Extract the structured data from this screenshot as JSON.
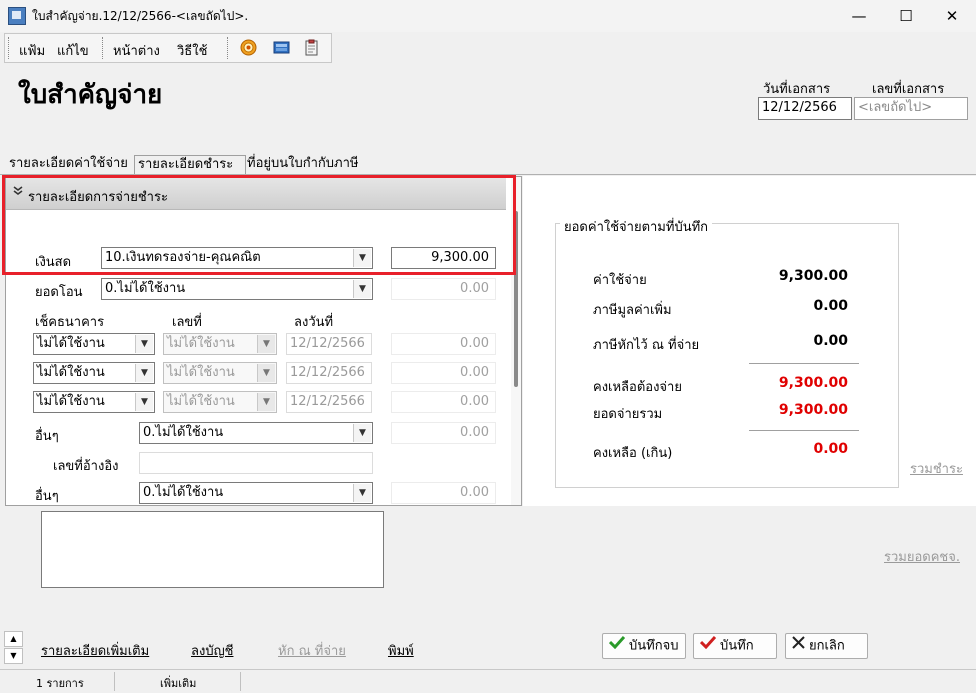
{
  "window": {
    "title": "ใบสำคัญจ่าย.12/12/2566-<เลขถัดไป>.",
    "minimize_glyph": "—",
    "maximize_glyph": "☐",
    "close_glyph": "✕"
  },
  "menu": {
    "items": [
      "แฟ้ม",
      "แก้ไข",
      "หน้าต่าง",
      "วิธีใช้"
    ]
  },
  "toolbar": {
    "icons": [
      "target-icon",
      "screen-icon",
      "clipboard-icon"
    ]
  },
  "header": {
    "page_title": "ใบสำคัญจ่าย",
    "doc_date_label": "วันที่เอกสาร",
    "doc_no_label": "เลขที่เอกสาร",
    "doc_date_value": "12/12/2566",
    "doc_no_placeholder": "<เลขถัดไป>"
  },
  "tabs": [
    "รายละเอียดค่าใช้จ่าย",
    "รายละเอียดชำระ",
    "ที่อยู่บนใบกำกับภาษี"
  ],
  "active_tab": 1,
  "payment_section": {
    "header": "รายละเอียดการจ่ายชำระ",
    "cash_label": "เงินสด",
    "cash_account": "10.เงินทดรองจ่าย-คุณคณิต",
    "cash_amount": "9,300.00",
    "transfer_label": "ยอดโอน",
    "transfer_account": "0.ไม่ได้ใช้งาน",
    "transfer_amount": "0.00",
    "cheque_bank_label": "เช็คธนาคาร",
    "cheque_no_label": "เลขที่",
    "cheque_date_label": "ลงวันที่",
    "cheques": [
      {
        "bank": "ไม่ได้ใช้งาน",
        "number": "ไม่ได้ใช้งาน",
        "date": "12/12/2566",
        "amount": "0.00"
      },
      {
        "bank": "ไม่ได้ใช้งาน",
        "number": "ไม่ได้ใช้งาน",
        "date": "12/12/2566",
        "amount": "0.00"
      },
      {
        "bank": "ไม่ได้ใช้งาน",
        "number": "ไม่ได้ใช้งาน",
        "date": "12/12/2566",
        "amount": "0.00"
      }
    ],
    "other1_label": "อื่นๆ",
    "other1_account": "0.ไม่ได้ใช้งาน",
    "other1_amount": "0.00",
    "ref_no_label": "เลขที่อ้างอิง",
    "ref_no_value": "",
    "other2_label": "อื่นๆ",
    "other2_account": "0.ไม่ได้ใช้งาน",
    "other2_amount": "0.00"
  },
  "summary": {
    "title": "ยอดค่าใช้จ่ายตามที่บันทึก",
    "expense_label": "ค่าใช้จ่าย",
    "expense_value": "9,300.00",
    "vat_label": "ภาษีมูลค่าเพิ่ม",
    "vat_value": "0.00",
    "wht_label": "ภาษีหักไว้ ณ ที่จ่าย",
    "wht_value": "0.00",
    "remaining_label": "คงเหลือต้องจ่าย",
    "remaining_value": "9,300.00",
    "paid_total_label": "ยอดจ่ายรวม",
    "paid_total_value": "9,300.00",
    "balance_label": "คงเหลือ (เกิน)",
    "balance_value": "0.00",
    "value_color_normal": "#000000",
    "value_color_alert": "#e00000"
  },
  "links": {
    "sum_payment": "รวมชำระ",
    "sum_expense": "รวมยอดคชจ.",
    "more_details": "รายละเอียดเพิ่มเติม",
    "post_ledger": "ลงบัญชี",
    "withholding": "หัก ณ ที่จ่าย",
    "print": "พิมพ์"
  },
  "buttons": {
    "save_close": "บันทึกจบ",
    "save": "บันทึก",
    "cancel": "ยกเลิก"
  },
  "status": {
    "count": "1 รายการ",
    "mode": "เพิ่มเติม"
  }
}
